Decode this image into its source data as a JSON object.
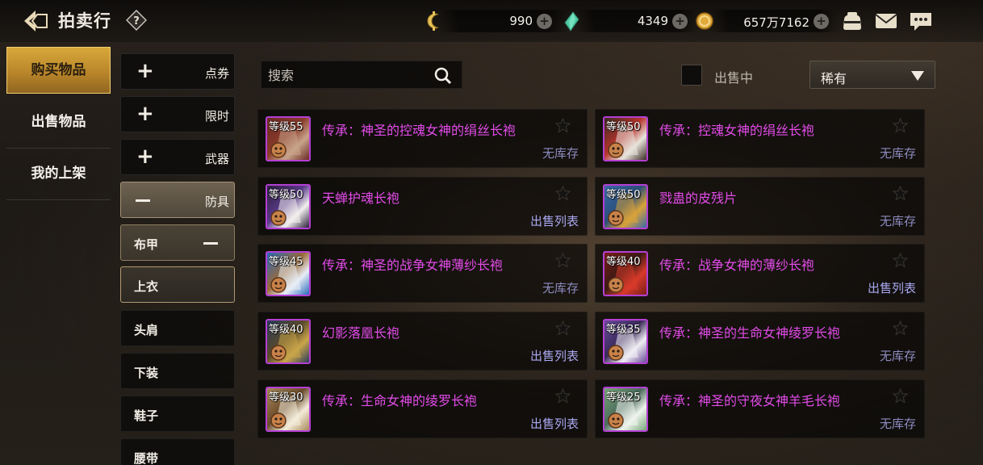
{
  "header": {
    "title": "拍卖行"
  },
  "currencies": [
    {
      "icon": "crescent-coin-icon",
      "value": "990"
    },
    {
      "icon": "green-crystal-icon",
      "value": "4349"
    },
    {
      "icon": "gold-coin-icon",
      "value": "657万7162"
    }
  ],
  "top_icons": [
    "pouch-icon",
    "mail-icon",
    "chat-icon"
  ],
  "left_tabs": [
    {
      "label": "购买物品",
      "active": true
    },
    {
      "label": "出售物品",
      "active": false
    },
    {
      "label": "我的上架",
      "active": false
    }
  ],
  "categories": [
    {
      "label": "点券",
      "expanded": false
    },
    {
      "label": "限时",
      "expanded": false
    },
    {
      "label": "武器",
      "expanded": false
    },
    {
      "label": "防具",
      "expanded": true
    }
  ],
  "subcategories": [
    {
      "label": "布甲",
      "type": "group"
    },
    {
      "label": "上衣",
      "type": "selected"
    },
    {
      "label": "头肩",
      "type": "normal"
    },
    {
      "label": "下装",
      "type": "normal"
    },
    {
      "label": "鞋子",
      "type": "normal"
    },
    {
      "label": "腰带",
      "type": "normal"
    }
  ],
  "search": {
    "placeholder": "搜索",
    "value": ""
  },
  "filters": {
    "on_sale_label": "出售中",
    "on_sale_checked": false,
    "rarity_selected": "稀有"
  },
  "colors": {
    "accent_gold": "#d9a93b",
    "item_name": "#e24be8",
    "item_border": "#b43fd3",
    "status": "#a9a8f0"
  },
  "items": [
    {
      "level": "等级55",
      "name": "传承：神圣的控魂女神的绢丝长袍",
      "status": "无库存",
      "stock": false
    },
    {
      "level": "等级50",
      "name": "传承：控魂女神的绢丝长袍",
      "status": "无库存",
      "stock": false
    },
    {
      "level": "等级50",
      "name": "天蝉护魂长袍",
      "status": "出售列表",
      "stock": true
    },
    {
      "level": "等级50",
      "name": "戮蛊的皮残片",
      "status": "无库存",
      "stock": false
    },
    {
      "level": "等级45",
      "name": "传承：神圣的战争女神薄纱长袍",
      "status": "无库存",
      "stock": false
    },
    {
      "level": "等级40",
      "name": "传承：战争女神的薄纱长袍",
      "status": "出售列表",
      "stock": true
    },
    {
      "level": "等级40",
      "name": "幻影落凰长袍",
      "status": "出售列表",
      "stock": true
    },
    {
      "level": "等级35",
      "name": "传承：神圣的生命女神绫罗长袍",
      "status": "无库存",
      "stock": false
    },
    {
      "level": "等级30",
      "name": "传承：生命女神的绫罗长袍",
      "status": "出售列表",
      "stock": true
    },
    {
      "level": "等级25",
      "name": "传承：神圣的守夜女神羊毛长袍",
      "status": "无库存",
      "stock": false
    }
  ]
}
